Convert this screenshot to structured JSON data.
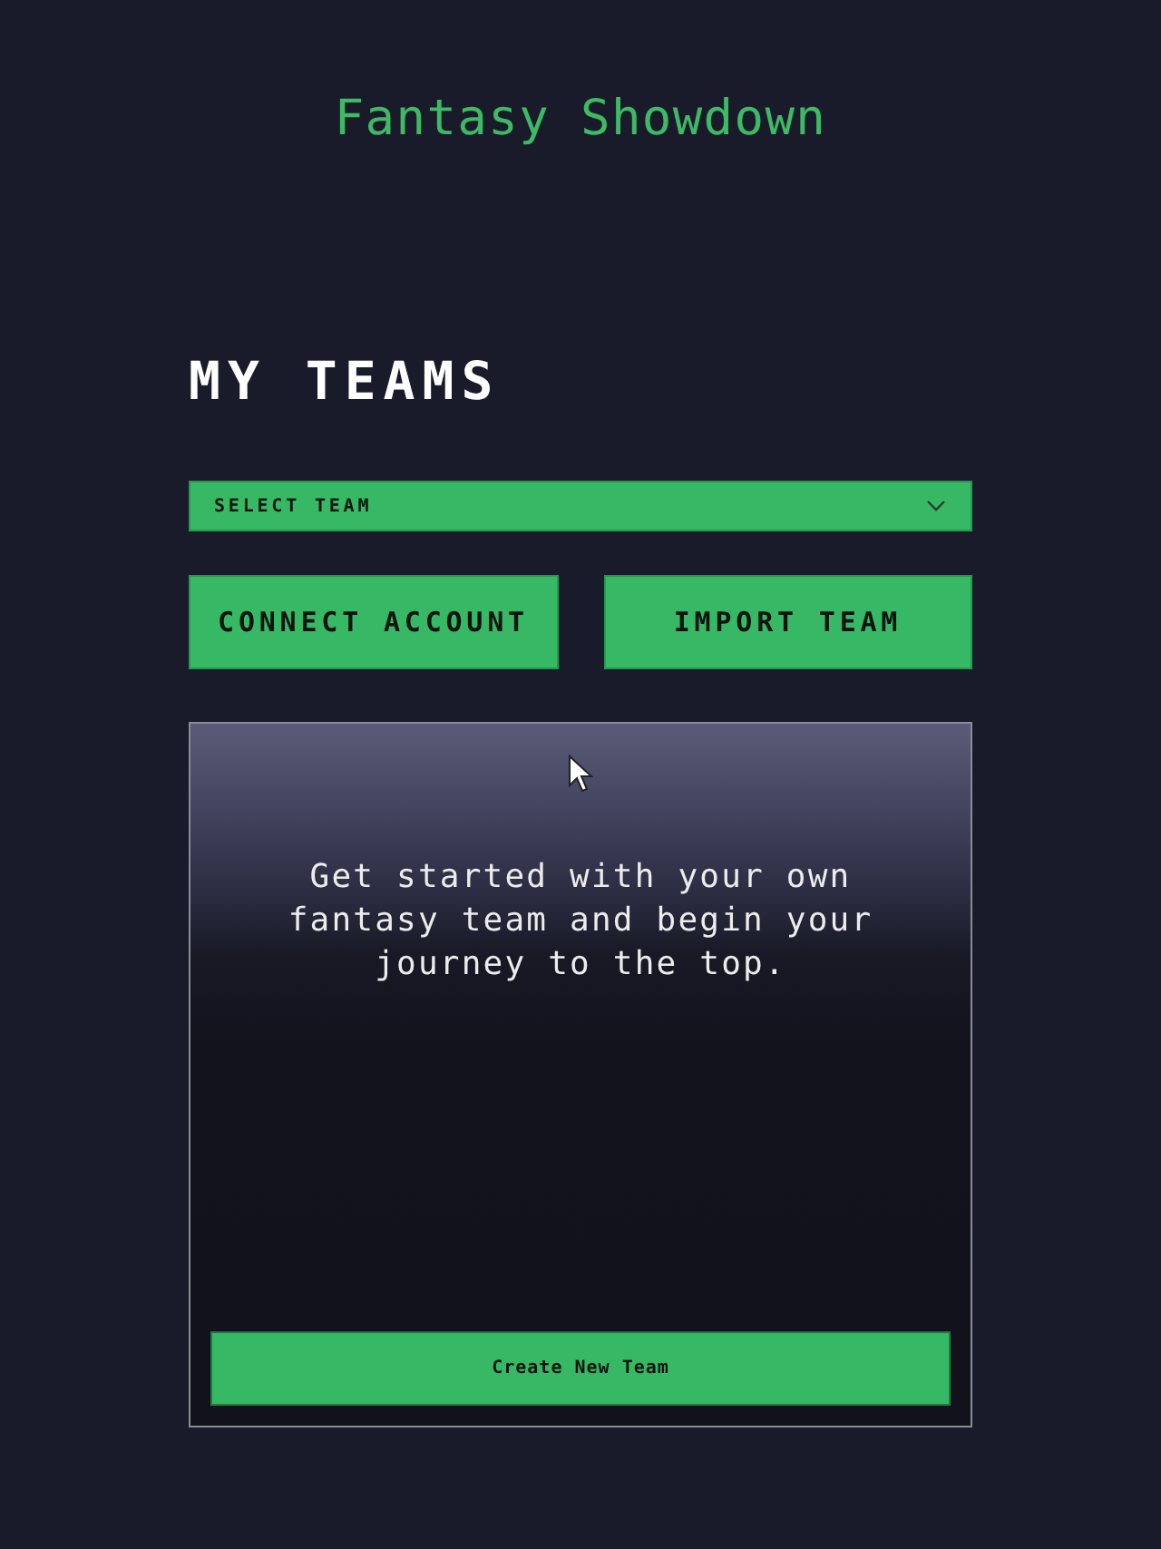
{
  "title": "Fantasy Showdown",
  "heading": "MY TEAMS",
  "team_select": {
    "placeholder": "SELECT TEAM"
  },
  "buttons": [
    "CONNECT ACCOUNT",
    "IMPORT TEAM"
  ],
  "card": {
    "message": "Get started with your own fantasy team and begin your journey to the top.",
    "button": "Create New Team"
  }
}
